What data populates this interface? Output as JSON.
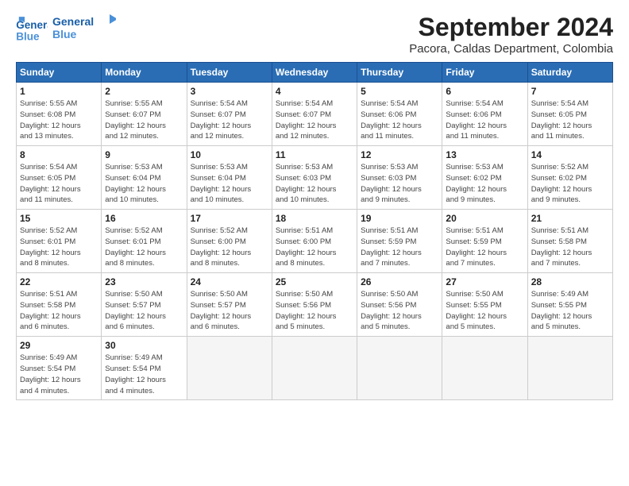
{
  "logo": {
    "line1": "General",
    "line2": "Blue"
  },
  "title": "September 2024",
  "subtitle": "Pacora, Caldas Department, Colombia",
  "days_of_week": [
    "Sunday",
    "Monday",
    "Tuesday",
    "Wednesday",
    "Thursday",
    "Friday",
    "Saturday"
  ],
  "weeks": [
    [
      {
        "day": "1",
        "info": "Sunrise: 5:55 AM\nSunset: 6:08 PM\nDaylight: 12 hours\nand 13 minutes."
      },
      {
        "day": "2",
        "info": "Sunrise: 5:55 AM\nSunset: 6:07 PM\nDaylight: 12 hours\nand 12 minutes."
      },
      {
        "day": "3",
        "info": "Sunrise: 5:54 AM\nSunset: 6:07 PM\nDaylight: 12 hours\nand 12 minutes."
      },
      {
        "day": "4",
        "info": "Sunrise: 5:54 AM\nSunset: 6:07 PM\nDaylight: 12 hours\nand 12 minutes."
      },
      {
        "day": "5",
        "info": "Sunrise: 5:54 AM\nSunset: 6:06 PM\nDaylight: 12 hours\nand 11 minutes."
      },
      {
        "day": "6",
        "info": "Sunrise: 5:54 AM\nSunset: 6:06 PM\nDaylight: 12 hours\nand 11 minutes."
      },
      {
        "day": "7",
        "info": "Sunrise: 5:54 AM\nSunset: 6:05 PM\nDaylight: 12 hours\nand 11 minutes."
      }
    ],
    [
      {
        "day": "8",
        "info": "Sunrise: 5:54 AM\nSunset: 6:05 PM\nDaylight: 12 hours\nand 11 minutes."
      },
      {
        "day": "9",
        "info": "Sunrise: 5:53 AM\nSunset: 6:04 PM\nDaylight: 12 hours\nand 10 minutes."
      },
      {
        "day": "10",
        "info": "Sunrise: 5:53 AM\nSunset: 6:04 PM\nDaylight: 12 hours\nand 10 minutes."
      },
      {
        "day": "11",
        "info": "Sunrise: 5:53 AM\nSunset: 6:03 PM\nDaylight: 12 hours\nand 10 minutes."
      },
      {
        "day": "12",
        "info": "Sunrise: 5:53 AM\nSunset: 6:03 PM\nDaylight: 12 hours\nand 9 minutes."
      },
      {
        "day": "13",
        "info": "Sunrise: 5:53 AM\nSunset: 6:02 PM\nDaylight: 12 hours\nand 9 minutes."
      },
      {
        "day": "14",
        "info": "Sunrise: 5:52 AM\nSunset: 6:02 PM\nDaylight: 12 hours\nand 9 minutes."
      }
    ],
    [
      {
        "day": "15",
        "info": "Sunrise: 5:52 AM\nSunset: 6:01 PM\nDaylight: 12 hours\nand 8 minutes."
      },
      {
        "day": "16",
        "info": "Sunrise: 5:52 AM\nSunset: 6:01 PM\nDaylight: 12 hours\nand 8 minutes."
      },
      {
        "day": "17",
        "info": "Sunrise: 5:52 AM\nSunset: 6:00 PM\nDaylight: 12 hours\nand 8 minutes."
      },
      {
        "day": "18",
        "info": "Sunrise: 5:51 AM\nSunset: 6:00 PM\nDaylight: 12 hours\nand 8 minutes."
      },
      {
        "day": "19",
        "info": "Sunrise: 5:51 AM\nSunset: 5:59 PM\nDaylight: 12 hours\nand 7 minutes."
      },
      {
        "day": "20",
        "info": "Sunrise: 5:51 AM\nSunset: 5:59 PM\nDaylight: 12 hours\nand 7 minutes."
      },
      {
        "day": "21",
        "info": "Sunrise: 5:51 AM\nSunset: 5:58 PM\nDaylight: 12 hours\nand 7 minutes."
      }
    ],
    [
      {
        "day": "22",
        "info": "Sunrise: 5:51 AM\nSunset: 5:58 PM\nDaylight: 12 hours\nand 6 minutes."
      },
      {
        "day": "23",
        "info": "Sunrise: 5:50 AM\nSunset: 5:57 PM\nDaylight: 12 hours\nand 6 minutes."
      },
      {
        "day": "24",
        "info": "Sunrise: 5:50 AM\nSunset: 5:57 PM\nDaylight: 12 hours\nand 6 minutes."
      },
      {
        "day": "25",
        "info": "Sunrise: 5:50 AM\nSunset: 5:56 PM\nDaylight: 12 hours\nand 5 minutes."
      },
      {
        "day": "26",
        "info": "Sunrise: 5:50 AM\nSunset: 5:56 PM\nDaylight: 12 hours\nand 5 minutes."
      },
      {
        "day": "27",
        "info": "Sunrise: 5:50 AM\nSunset: 5:55 PM\nDaylight: 12 hours\nand 5 minutes."
      },
      {
        "day": "28",
        "info": "Sunrise: 5:49 AM\nSunset: 5:55 PM\nDaylight: 12 hours\nand 5 minutes."
      }
    ],
    [
      {
        "day": "29",
        "info": "Sunrise: 5:49 AM\nSunset: 5:54 PM\nDaylight: 12 hours\nand 4 minutes."
      },
      {
        "day": "30",
        "info": "Sunrise: 5:49 AM\nSunset: 5:54 PM\nDaylight: 12 hours\nand 4 minutes."
      },
      {
        "day": "",
        "info": ""
      },
      {
        "day": "",
        "info": ""
      },
      {
        "day": "",
        "info": ""
      },
      {
        "day": "",
        "info": ""
      },
      {
        "day": "",
        "info": ""
      }
    ]
  ]
}
